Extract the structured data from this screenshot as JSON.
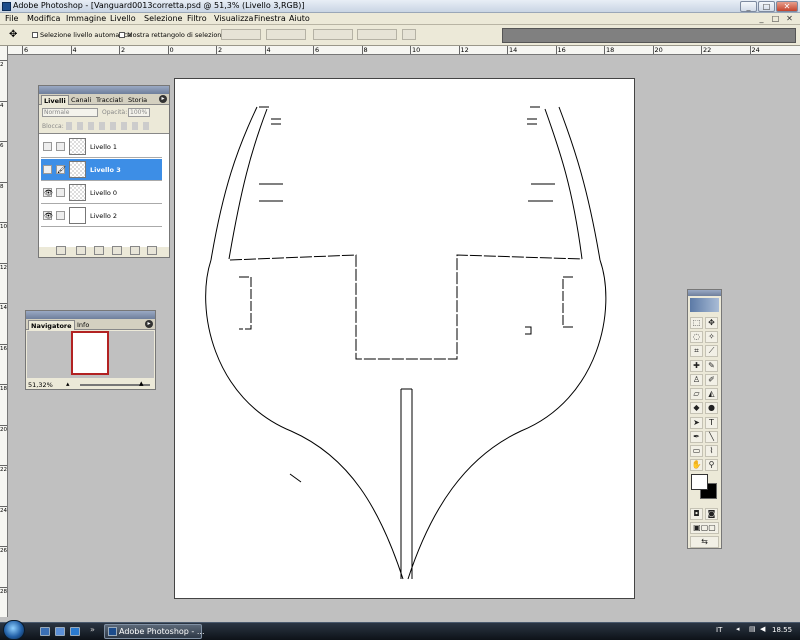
{
  "window": {
    "title": "Adobe Photoshop - [Vanguard0013corretta.psd @ 51,3% (Livello 3,RGB)]",
    "min": "_",
    "max": "□",
    "close": "✕"
  },
  "menu": [
    "File",
    "Modifica",
    "Immagine",
    "Livello",
    "Selezione",
    "Filtro",
    "Visualizza",
    "Finestra",
    "Aiuto"
  ],
  "options": {
    "auto_select": "Selezione livello automatica",
    "show_bbox": "Mostra rettangolo di selezione"
  },
  "rulers": {
    "h": [
      "6",
      "4",
      "2",
      "0",
      "2",
      "4",
      "6",
      "8",
      "10",
      "12",
      "14",
      "16",
      "18",
      "20",
      "22",
      "24"
    ],
    "v": [
      "2",
      "4",
      "6",
      "8",
      "10",
      "12",
      "14",
      "16",
      "18",
      "20",
      "22",
      "24",
      "26",
      "28"
    ]
  },
  "layers_panel": {
    "tabs": [
      "Livelli",
      "Canali",
      "Tracciati",
      "Storia"
    ],
    "blend_mode": "Normale",
    "opacity_label": "Opacità:",
    "opacity_value": "100%",
    "lock_label": "Blocca:",
    "layers": [
      {
        "name": "Livello 1",
        "visible": false,
        "selected": false,
        "link": ""
      },
      {
        "name": "Livello 3",
        "visible": false,
        "selected": true,
        "link": "🖌"
      },
      {
        "name": "Livello 0",
        "visible": true,
        "selected": false,
        "link": ""
      },
      {
        "name": "Livello 2",
        "visible": true,
        "selected": false,
        "link": ""
      }
    ],
    "eye": "👁"
  },
  "navigator": {
    "tabs": [
      "Navigatore",
      "Info"
    ],
    "zoom": "51,32%"
  },
  "taskbar": {
    "app": "Adobe Photoshop - ...",
    "lang": "IT",
    "time": "18.55"
  },
  "colors": {
    "selected_layer": "#3d8ee6",
    "titlebar": "#c9d5e4",
    "nav_frame": "#b22222"
  }
}
